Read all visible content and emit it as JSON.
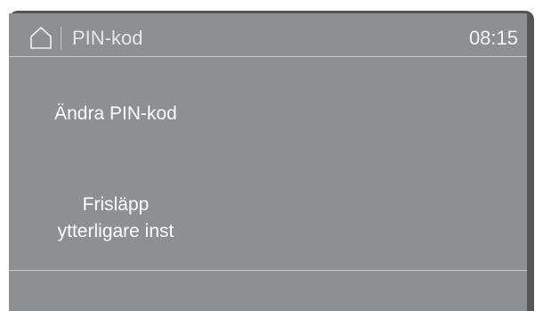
{
  "header": {
    "home_icon": "home-icon",
    "title": "PIN-kod",
    "clock": "08:15"
  },
  "menu": {
    "items": [
      {
        "lines": [
          "Ändra PIN-kod"
        ]
      },
      {
        "lines": [
          "Frisläpp",
          "ytterligare inst"
        ]
      }
    ]
  },
  "colors": {
    "screen_bg": "#8e8f90",
    "bezel": "#555555",
    "text": "#ffffff",
    "divider": "#c9c9c9"
  }
}
